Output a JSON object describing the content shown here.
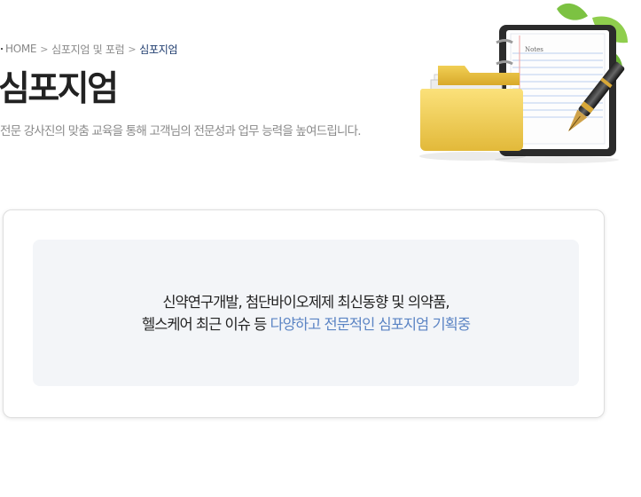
{
  "breadcrumb": {
    "items": [
      "HOME",
      "심포지엄 및 포럼",
      "심포지엄"
    ]
  },
  "header": {
    "title": "심포지엄",
    "description": "전문 강사진의 맞춤 교육을 통해 고객님의 전문성과 업무 능력을 높여드립니다."
  },
  "illustration": {
    "notebook_label": "Notes"
  },
  "info_card": {
    "line1": "신약연구개발, 첨단바이오제제 최신동향 및 의약품,",
    "line2_prefix": "헬스케어 최근 이슈 등 ",
    "line2_highlight": "다양하고 전문적인 심포지엄 기획중",
    "highlight_color": "#5b84c4"
  }
}
